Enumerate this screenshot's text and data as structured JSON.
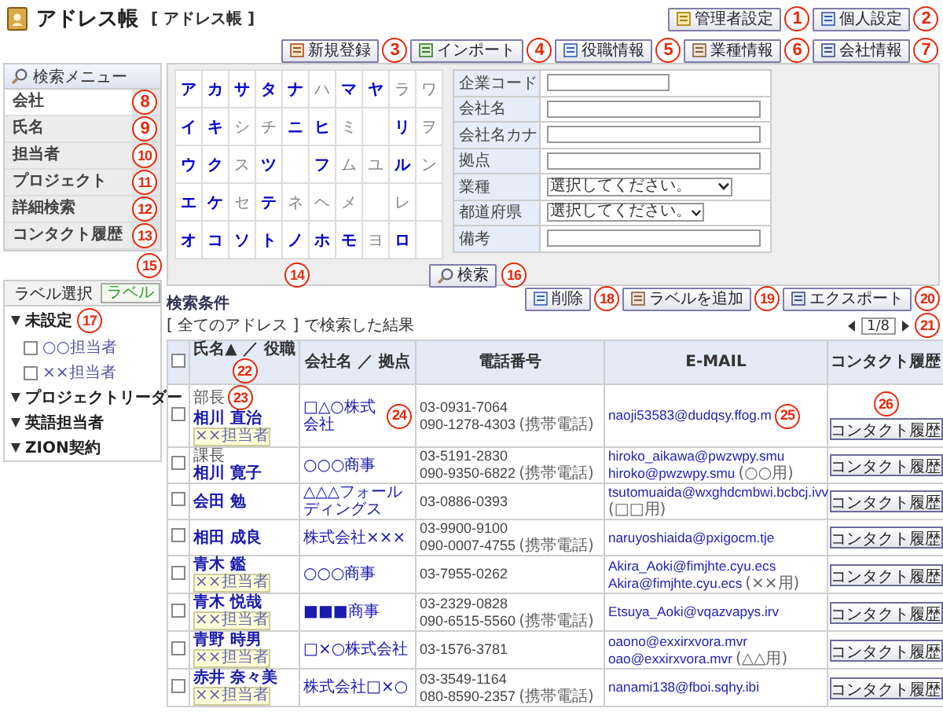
{
  "header": {
    "title": "アドレス帳",
    "subtitle": "[ アドレス帳 ]",
    "top_buttons": [
      {
        "label": "管理者設定",
        "callout": "1"
      },
      {
        "label": "個人設定",
        "callout": "2"
      }
    ],
    "tool_buttons": [
      {
        "label": "新規登録",
        "callout": "3"
      },
      {
        "label": "インポート",
        "callout": "4"
      },
      {
        "label": "役職情報",
        "callout": "5"
      },
      {
        "label": "業種情報",
        "callout": "6"
      },
      {
        "label": "会社情報",
        "callout": "7"
      }
    ]
  },
  "search_menu": {
    "title": "検索メニュー",
    "items": [
      {
        "label": "会社",
        "selected": true,
        "callout": "8"
      },
      {
        "label": "氏名",
        "selected": false,
        "callout": "9"
      },
      {
        "label": "担当者",
        "selected": false,
        "callout": "10"
      },
      {
        "label": "プロジェクト",
        "selected": false,
        "callout": "11"
      },
      {
        "label": "詳細検索",
        "selected": false,
        "callout": "12"
      },
      {
        "label": "コンタクト履歴",
        "selected": false,
        "callout": "13"
      }
    ]
  },
  "kana_grid": [
    [
      {
        "kind": "kana",
        "char": "ア",
        "active": true
      },
      {
        "kind": "kana",
        "char": "カ",
        "active": true
      },
      {
        "kind": "kana",
        "char": "サ",
        "active": true
      },
      {
        "kind": "kana",
        "char": "タ",
        "active": true
      },
      {
        "kind": "kana",
        "char": "ナ",
        "active": true
      },
      {
        "kind": "kana",
        "char": "ハ",
        "active": false
      },
      {
        "kind": "kana",
        "char": "マ",
        "active": true
      },
      {
        "kind": "kana",
        "char": "ヤ",
        "active": true
      },
      {
        "kind": "kana",
        "char": "ラ",
        "active": false
      },
      {
        "kind": "kana",
        "char": "ワ",
        "active": false
      }
    ],
    [
      {
        "kind": "kana",
        "char": "イ",
        "active": true
      },
      {
        "kind": "kana",
        "char": "キ",
        "active": true
      },
      {
        "kind": "kana",
        "char": "シ",
        "active": false
      },
      {
        "kind": "kana",
        "char": "チ",
        "active": false
      },
      {
        "kind": "kana",
        "char": "ニ",
        "active": true
      },
      {
        "kind": "kana",
        "char": "ヒ",
        "active": true
      },
      {
        "kind": "kana",
        "char": "ミ",
        "active": false
      },
      {
        "kind": "blank"
      },
      {
        "kind": "kana",
        "char": "リ",
        "active": true
      },
      {
        "kind": "kana",
        "char": "ヲ",
        "active": false
      }
    ],
    [
      {
        "kind": "kana",
        "char": "ウ",
        "active": true
      },
      {
        "kind": "kana",
        "char": "ク",
        "active": true
      },
      {
        "kind": "kana",
        "char": "ス",
        "active": false
      },
      {
        "kind": "kana",
        "char": "ツ",
        "active": true
      },
      {
        "kind": "blank"
      },
      {
        "kind": "kana",
        "char": "フ",
        "active": true
      },
      {
        "kind": "kana",
        "char": "ム",
        "active": false
      },
      {
        "kind": "kana",
        "char": "ユ",
        "active": false
      },
      {
        "kind": "kana",
        "char": "ル",
        "active": true
      },
      {
        "kind": "kana",
        "char": "ン",
        "active": false
      }
    ],
    [
      {
        "kind": "kana",
        "char": "エ",
        "active": true
      },
      {
        "kind": "kana",
        "char": "ケ",
        "active": true
      },
      {
        "kind": "kana",
        "char": "セ",
        "active": false
      },
      {
        "kind": "kana",
        "char": "テ",
        "active": true
      },
      {
        "kind": "kana",
        "char": "ネ",
        "active": false
      },
      {
        "kind": "kana",
        "char": "ヘ",
        "active": false
      },
      {
        "kind": "kana",
        "char": "メ",
        "active": false
      },
      {
        "kind": "blank"
      },
      {
        "kind": "kana",
        "char": "レ",
        "active": false
      },
      {
        "kind": "blank"
      }
    ],
    [
      {
        "kind": "kana",
        "char": "オ",
        "active": true
      },
      {
        "kind": "kana",
        "char": "コ",
        "active": true
      },
      {
        "kind": "kana",
        "char": "ソ",
        "active": true
      },
      {
        "kind": "kana",
        "char": "ト",
        "active": true
      },
      {
        "kind": "kana",
        "char": "ノ",
        "active": true
      },
      {
        "kind": "kana",
        "char": "ホ",
        "active": true
      },
      {
        "kind": "kana",
        "char": "モ",
        "active": true
      },
      {
        "kind": "kana",
        "char": "ヨ",
        "active": false
      },
      {
        "kind": "kana",
        "char": "ロ",
        "active": true
      },
      {
        "kind": "blank"
      }
    ]
  ],
  "kana_callout": "14",
  "search_form": {
    "fields": [
      {
        "label": "企業コード",
        "kind": "text",
        "wide": false
      },
      {
        "label": "会社名",
        "kind": "text",
        "wide": true
      },
      {
        "label": "会社名カナ",
        "kind": "text",
        "wide": true
      },
      {
        "label": "拠点",
        "kind": "text",
        "wide": true
      },
      {
        "label": "業種",
        "kind": "select",
        "wide": true,
        "value": "選択してください。"
      },
      {
        "label": "都道府県",
        "kind": "select",
        "wide": false,
        "value": "選択してください。"
      },
      {
        "label": "備考",
        "kind": "text",
        "wide": true
      }
    ],
    "button": "検索",
    "button_callout": "16"
  },
  "label_panel": {
    "title": "ラベル選択",
    "button": "ラベル",
    "button_callout": "15",
    "tree_callout": "17",
    "tree": [
      {
        "label": "未設定",
        "expanded": true,
        "children": [
          {
            "label": "○○担当者",
            "checked": false
          },
          {
            "label": "××担当者",
            "checked": false
          }
        ]
      },
      {
        "label": "プロジェクトリーダー",
        "expanded": true
      },
      {
        "label": "英語担当者",
        "expanded": true
      },
      {
        "label": "ZION契約",
        "expanded": true
      }
    ]
  },
  "results": {
    "title": "検索条件",
    "summary": "[ 全てのアドレス ] で検索した結果",
    "actions": [
      {
        "label": "削除",
        "callout": "18"
      },
      {
        "label": "ラベルを追加",
        "callout": "19"
      },
      {
        "label": "エクスポート",
        "callout": "20"
      }
    ],
    "pager": "1/8",
    "pager_callout": "21",
    "select_all_checked": false,
    "columns": [
      {
        "label": "氏名▲ ／ 役職",
        "callout": "22"
      },
      {
        "label": "会社名 ／ 拠点"
      },
      {
        "label": "電話番号"
      },
      {
        "label": "E-MAIL"
      },
      {
        "label": "コンタクト履歴"
      }
    ],
    "rows": [
      {
        "checked": false,
        "position": "部長",
        "name": "相川 直治",
        "tag": "××担当者",
        "company": "□△○株式会社",
        "phones": [
          {
            "number": "03-0931-7064"
          },
          {
            "number": "090-1278-4303",
            "note": "(携帯電話)"
          }
        ],
        "emails": [
          {
            "address": "naoji53583@dudqsy.ffog.m"
          }
        ],
        "contact_button": "コンタクト履歴",
        "callouts": {
          "name": "23",
          "company": "24",
          "email": "25",
          "contact": "26"
        }
      },
      {
        "checked": false,
        "position": "課長",
        "name": "相川 寛子",
        "company": "○○○商事",
        "phones": [
          {
            "number": "03-5191-2830"
          },
          {
            "number": "090-9350-6822",
            "note": "(携帯電話)"
          }
        ],
        "emails": [
          {
            "address": "hiroko_aikawa@pwzwpy.smu"
          },
          {
            "address": "hiroko@pwzwpy.smu",
            "note": "(○○用)"
          }
        ],
        "contact_button": "コンタクト履歴"
      },
      {
        "checked": false,
        "name": "会田 勉",
        "company": "△△△フォールディングス",
        "phones": [
          {
            "number": "03-0886-0393"
          }
        ],
        "emails": [
          {
            "address": "tsutomuaida@wxghdcmbwi.bcbcj.ivv",
            "note": "(□□用)",
            "note_below": true
          }
        ],
        "contact_button": "コンタクト履歴"
      },
      {
        "checked": false,
        "name": "相田 成良",
        "company": "株式会社×××",
        "phones": [
          {
            "number": "03-9900-9100"
          },
          {
            "number": "090-0007-4755",
            "note": "(携帯電話)"
          }
        ],
        "emails": [
          {
            "address": "naruyoshiaida@pxigocm.tje"
          }
        ],
        "contact_button": "コンタクト履歴"
      },
      {
        "checked": false,
        "name": "青木 鑑",
        "tag": "××担当者",
        "company": "○○○商事",
        "phones": [
          {
            "number": "03-7955-0262"
          }
        ],
        "emails": [
          {
            "address": "Akira_Aoki@fimjhte.cyu.ecs"
          },
          {
            "address": "Akira@fimjhte.cyu.ecs",
            "note": "(××用)"
          }
        ],
        "contact_button": "コンタクト履歴"
      },
      {
        "checked": false,
        "name": "青木 悦哉",
        "tag": "××担当者",
        "company": "■■■商事",
        "phones": [
          {
            "number": "03-2329-0828"
          },
          {
            "number": "090-6515-5560",
            "note": "(携帯電話)"
          }
        ],
        "emails": [
          {
            "address": "Etsuya_Aoki@vqazvapys.irv"
          }
        ],
        "contact_button": "コンタクト履歴"
      },
      {
        "checked": false,
        "name": "青野 時男",
        "tag": "××担当者",
        "company": "□×○株式会社",
        "phones": [
          {
            "number": "03-1576-3781"
          }
        ],
        "emails": [
          {
            "address": "oaono@exxirxvora.mvr"
          },
          {
            "address": "oao@exxirxvora.mvr",
            "note": "(△△用)"
          }
        ],
        "contact_button": "コンタクト履歴"
      },
      {
        "checked": false,
        "name": "赤井 奈々美",
        "tag": "××担当者",
        "company": "株式会社□×○",
        "phones": [
          {
            "number": "03-3549-1164"
          },
          {
            "number": "080-8590-2357",
            "note": "(携帯電話)"
          }
        ],
        "emails": [
          {
            "address": "nanami138@fboi.sqhy.ibi"
          }
        ],
        "contact_button": "コンタクト履歴"
      }
    ]
  }
}
